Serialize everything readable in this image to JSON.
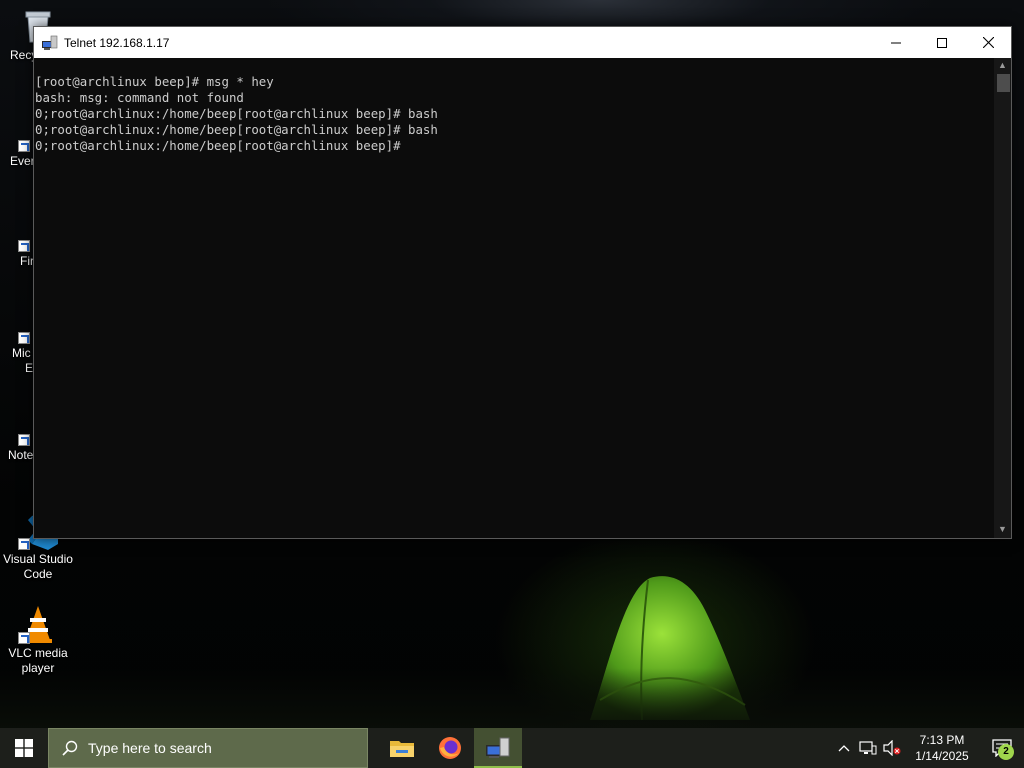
{
  "desktop": {
    "icons": [
      {
        "label": "Recycle Bin",
        "name": "recycle-bin-icon"
      },
      {
        "label": "Everything",
        "name": "everything-icon"
      },
      {
        "label": "Firefox",
        "name": "firefox-icon"
      },
      {
        "label": "Microsoft Edge",
        "name": "edge-icon"
      },
      {
        "label": "Notepad++",
        "name": "notepad-plus-plus-icon"
      },
      {
        "label": "Visual Studio Code",
        "name": "vscode-icon"
      },
      {
        "label": "VLC media player",
        "name": "vlc-icon"
      }
    ],
    "visible_labels": {
      "recycle": "Recy",
      "everything": "Ever",
      "firefox": "Fir",
      "edge_line1": "Mic",
      "edge_line2": "E",
      "notepad": "Note",
      "vscode_line1": "Visual Studio",
      "vscode_line2": "Code",
      "vlc_line1": "VLC media",
      "vlc_line2": "player"
    }
  },
  "window": {
    "title": "Telnet 192.168.1.17",
    "controls": {
      "minimize": "minimize",
      "maximize": "maximize",
      "close": "close"
    },
    "terminal_lines": [
      "[root@archlinux beep]# msg * hey",
      "bash: msg: command not found",
      "0;root@archlinux:/home/beep[root@archlinux beep]# bash",
      "0;root@archlinux:/home/beep[root@archlinux beep]# bash",
      "0;root@archlinux:/home/beep[root@archlinux beep]#"
    ]
  },
  "taskbar": {
    "search_placeholder": "Type here to search",
    "apps": [
      {
        "name": "file-explorer-icon",
        "active": false
      },
      {
        "name": "firefox-icon",
        "active": false
      },
      {
        "name": "telnet-icon",
        "active": true
      }
    ],
    "clock": {
      "time": "7:13 PM",
      "date": "1/14/2025"
    },
    "notification_count": "2"
  },
  "colors": {
    "terminal_bg": "#0c0c0c",
    "terminal_fg": "#cccccc",
    "taskbar_bg": "#1d1f1b",
    "search_bg": "#5e6a4b",
    "accent": "#8fbf4a"
  }
}
